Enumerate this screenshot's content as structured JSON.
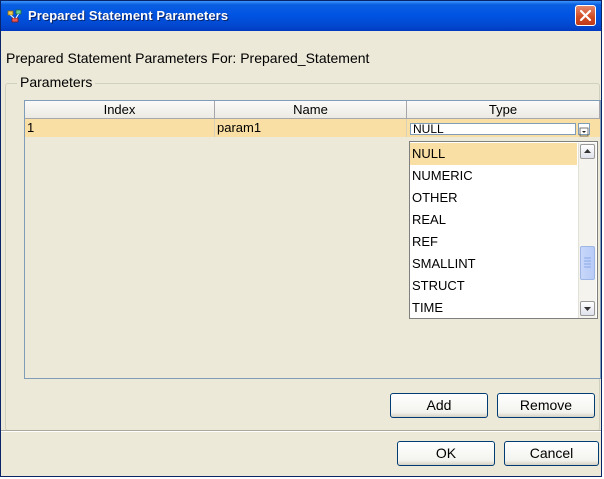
{
  "window": {
    "title": "Prepared Statement Parameters",
    "icon": "app-icon",
    "close_icon": "close-icon"
  },
  "header": {
    "label": "Prepared Statement Parameters For: Prepared_Statement"
  },
  "parameters": {
    "legend": "Parameters",
    "columns": [
      "Index",
      "Name",
      "Type"
    ],
    "rows": [
      {
        "index": "1",
        "name": "param1",
        "type": "NULL"
      }
    ]
  },
  "type_dropdown": {
    "selected": "NULL",
    "options": [
      "NULL",
      "NUMERIC",
      "OTHER",
      "REAL",
      "REF",
      "SMALLINT",
      "STRUCT",
      "TIME"
    ]
  },
  "buttons": {
    "add": "Add",
    "remove": "Remove",
    "ok": "OK",
    "cancel": "Cancel"
  },
  "colors": {
    "titlebar": "#0054e3",
    "selection": "#fadfa4",
    "dialog_bg": "#ece9d8"
  }
}
